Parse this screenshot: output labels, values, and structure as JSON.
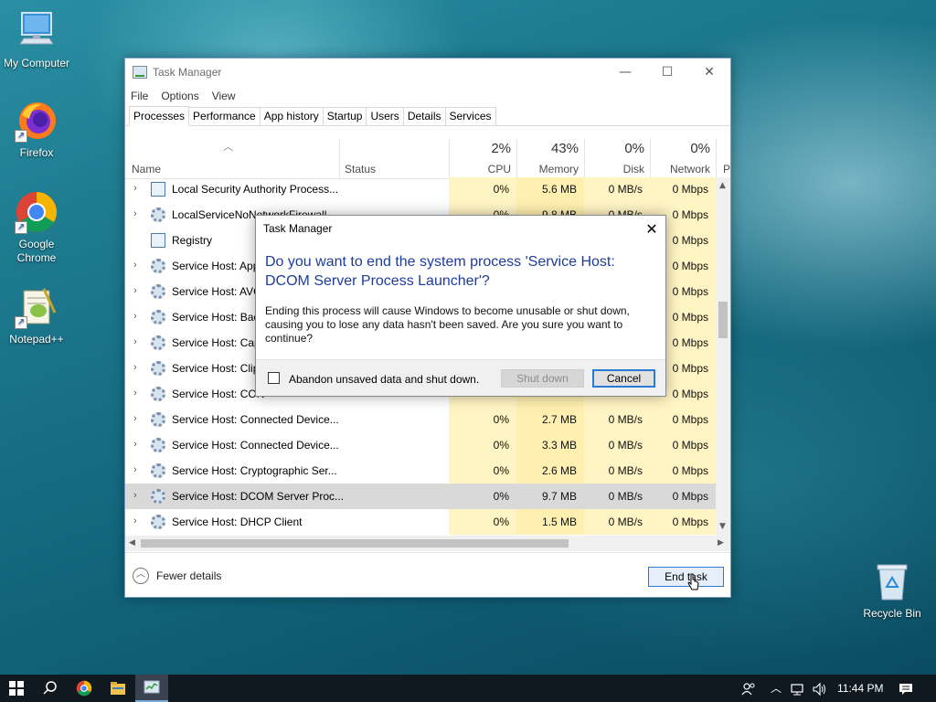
{
  "desktop": {
    "icons": [
      {
        "label": "My Computer",
        "icon": "computer-icon"
      },
      {
        "label": "Firefox",
        "icon": "firefox-icon"
      },
      {
        "label": "Google Chrome",
        "icon": "chrome-icon"
      },
      {
        "label": "Notepad++",
        "icon": "notepadpp-icon"
      },
      {
        "label": "Recycle Bin",
        "icon": "recycle-bin-icon"
      }
    ]
  },
  "task_manager": {
    "title": "Task Manager",
    "menu": [
      "File",
      "Options",
      "View"
    ],
    "tabs": [
      "Processes",
      "Performance",
      "App history",
      "Startup",
      "Users",
      "Details",
      "Services"
    ],
    "active_tab": "Processes",
    "columns": {
      "name": "Name",
      "status": "Status",
      "cpu": {
        "pct": "2%",
        "label": "CPU"
      },
      "memory": {
        "pct": "43%",
        "label": "Memory"
      },
      "disk": {
        "pct": "0%",
        "label": "Disk"
      },
      "network": {
        "pct": "0%",
        "label": "Network"
      },
      "power_partial": "P"
    },
    "rows": [
      {
        "name": "Local Security Authority Process...",
        "cpu": "0%",
        "memory": "5.6 MB",
        "disk": "0 MB/s",
        "network": "0 Mbps",
        "icon": "window"
      },
      {
        "name": "LocalServiceNoNetworkFirewall ...",
        "cpu": "0%",
        "memory": "9.8 MB",
        "disk": "0 MB/s",
        "network": "0 Mbps",
        "icon": "gear"
      },
      {
        "name": "Registry",
        "cpu": "",
        "memory": "",
        "disk": "",
        "network": "0 Mbps",
        "icon": "window"
      },
      {
        "name": "Service Host: App",
        "cpu": "",
        "memory": "",
        "disk": "",
        "network": "0 Mbps",
        "icon": "gear"
      },
      {
        "name": "Service Host: AVC",
        "cpu": "",
        "memory": "",
        "disk": "",
        "network": "0 Mbps",
        "icon": "gear"
      },
      {
        "name": "Service Host: Bacl",
        "cpu": "",
        "memory": "",
        "disk": "",
        "network": "0 Mbps",
        "icon": "gear"
      },
      {
        "name": "Service Host: Cap",
        "cpu": "",
        "memory": "",
        "disk": "",
        "network": "0 Mbps",
        "icon": "gear"
      },
      {
        "name": "Service Host: Clip",
        "cpu": "",
        "memory": "",
        "disk": "",
        "network": "0 Mbps",
        "icon": "gear"
      },
      {
        "name": "Service Host: CON",
        "cpu": "",
        "memory": "",
        "disk": "",
        "network": "0 Mbps",
        "icon": "gear"
      },
      {
        "name": "Service Host: Connected Device...",
        "cpu": "0%",
        "memory": "2.7 MB",
        "disk": "0 MB/s",
        "network": "0 Mbps",
        "icon": "gear"
      },
      {
        "name": "Service Host: Connected Device...",
        "cpu": "0%",
        "memory": "3.3 MB",
        "disk": "0 MB/s",
        "network": "0 Mbps",
        "icon": "gear"
      },
      {
        "name": "Service Host: Cryptographic Ser...",
        "cpu": "0%",
        "memory": "2.6 MB",
        "disk": "0 MB/s",
        "network": "0 Mbps",
        "icon": "gear"
      },
      {
        "name": "Service Host: DCOM Server Proc...",
        "cpu": "0%",
        "memory": "9.7 MB",
        "disk": "0 MB/s",
        "network": "0 Mbps",
        "icon": "gear",
        "selected": true
      },
      {
        "name": "Service Host: DHCP Client",
        "cpu": "0%",
        "memory": "1.5 MB",
        "disk": "0 MB/s",
        "network": "0 Mbps",
        "icon": "gear"
      }
    ],
    "fewer_details": "Fewer details",
    "end_task": "End task"
  },
  "dialog": {
    "title": "Task Manager",
    "heading": "Do you want to end the system process 'Service Host: DCOM Server Process Launcher'?",
    "body": "Ending this process will cause Windows to become unusable or shut down, causing you to lose any data hasn't been saved. Are you sure you want to continue?",
    "checkbox_label": "Abandon unsaved data and shut down.",
    "checkbox_checked": false,
    "shutdown_label": "Shut down",
    "cancel_label": "Cancel"
  },
  "taskbar": {
    "time": "11:44 PM",
    "items": [
      "start-icon",
      "search-icon",
      "chrome-icon",
      "file-explorer-icon",
      "task-manager-icon"
    ]
  }
}
